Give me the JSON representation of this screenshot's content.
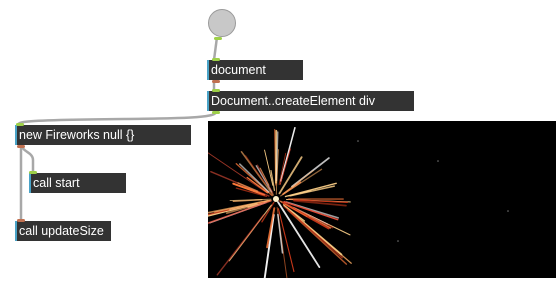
{
  "nodes": {
    "document": {
      "label": "document"
    },
    "create_element": {
      "label": "Document..createElement div"
    },
    "fireworks": {
      "label": "new Fireworks null {}"
    },
    "call_start": {
      "label": "call start"
    },
    "call_update_size": {
      "label": "call updateSize"
    }
  },
  "colors": {
    "node_bg": "#333333",
    "node_text": "#ffffff",
    "accent": "#4aa3c7",
    "port": "#c07050",
    "port_active": "#9ed048",
    "wire": "#a8a8a8",
    "canvas_bg": "#000000"
  },
  "fireworks_colors": [
    "#ff7a3a",
    "#ffb066",
    "#ffd28a",
    "#e8503a",
    "#c8381a",
    "#ffffff"
  ]
}
